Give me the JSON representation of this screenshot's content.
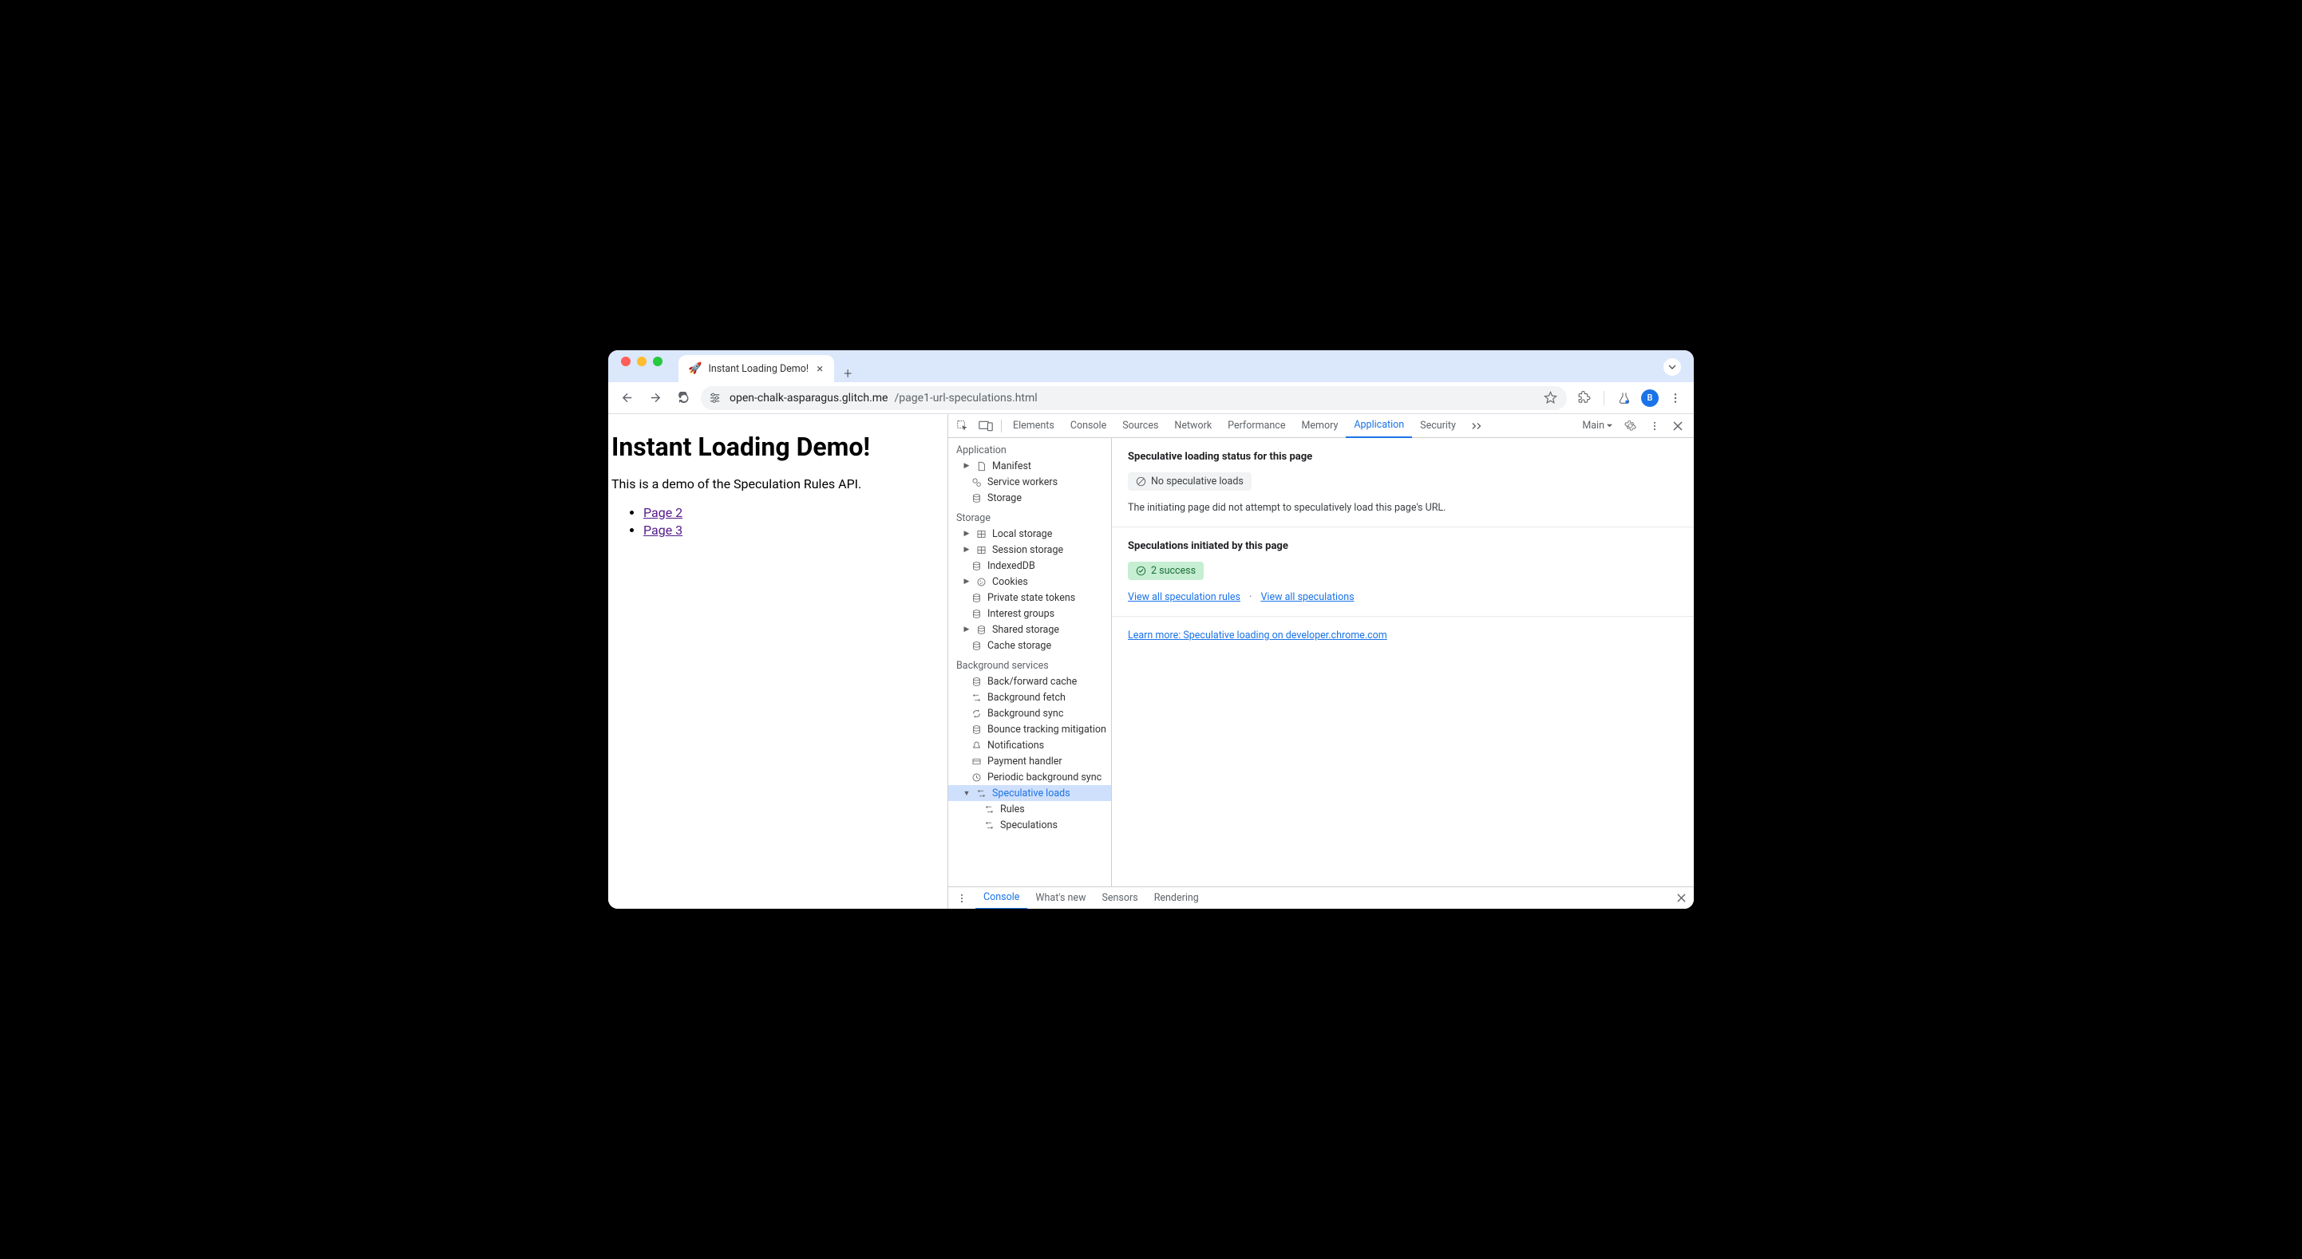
{
  "browser": {
    "tab_title": "Instant Loading Demo!",
    "tab_favicon": "🚀",
    "url_host": "open-chalk-asparagus.glitch.me",
    "url_path": "/page1-url-speculations.html",
    "avatar_letter": "B"
  },
  "page": {
    "heading": "Instant Loading Demo!",
    "paragraph": "This is a demo of the Speculation Rules API.",
    "links": [
      "Page 2",
      "Page 3"
    ]
  },
  "devtools": {
    "tabs": [
      "Elements",
      "Console",
      "Sources",
      "Network",
      "Performance",
      "Memory",
      "Application",
      "Security"
    ],
    "active_tab": "Application",
    "target_label": "Main",
    "sidebar": {
      "application": {
        "label": "Application",
        "items": [
          {
            "label": "Manifest",
            "icon": "file",
            "expandable": true
          },
          {
            "label": "Service workers",
            "icon": "gears"
          },
          {
            "label": "Storage",
            "icon": "db"
          }
        ]
      },
      "storage": {
        "label": "Storage",
        "items": [
          {
            "label": "Local storage",
            "icon": "grid",
            "expandable": true
          },
          {
            "label": "Session storage",
            "icon": "grid",
            "expandable": true
          },
          {
            "label": "IndexedDB",
            "icon": "db"
          },
          {
            "label": "Cookies",
            "icon": "cookie",
            "expandable": true
          },
          {
            "label": "Private state tokens",
            "icon": "db"
          },
          {
            "label": "Interest groups",
            "icon": "db"
          },
          {
            "label": "Shared storage",
            "icon": "db",
            "expandable": true
          },
          {
            "label": "Cache storage",
            "icon": "db"
          }
        ]
      },
      "background": {
        "label": "Background services",
        "items": [
          {
            "label": "Back/forward cache",
            "icon": "db"
          },
          {
            "label": "Background fetch",
            "icon": "arrows"
          },
          {
            "label": "Background sync",
            "icon": "sync"
          },
          {
            "label": "Bounce tracking mitigation",
            "icon": "db"
          },
          {
            "label": "Notifications",
            "icon": "bell"
          },
          {
            "label": "Payment handler",
            "icon": "card"
          },
          {
            "label": "Periodic background sync",
            "icon": "clock"
          },
          {
            "label": "Speculative loads",
            "icon": "arrows",
            "expanded": true,
            "selected": true
          },
          {
            "label": "Rules",
            "icon": "arrows",
            "child": true
          },
          {
            "label": "Speculations",
            "icon": "arrows",
            "child": true
          }
        ]
      }
    },
    "panel": {
      "status_heading": "Speculative loading status for this page",
      "status_badge": "No speculative loads",
      "status_desc": "The initiating page did not attempt to speculatively load this page's URL.",
      "initiated_heading": "Speculations initiated by this page",
      "success_badge": "2 success",
      "link_rules": "View all speculation rules",
      "link_specs": "View all speculations",
      "learn_more": "Learn more: Speculative loading on developer.chrome.com"
    },
    "drawer": {
      "tabs": [
        "Console",
        "What's new",
        "Sensors",
        "Rendering"
      ],
      "active": "Console"
    }
  }
}
